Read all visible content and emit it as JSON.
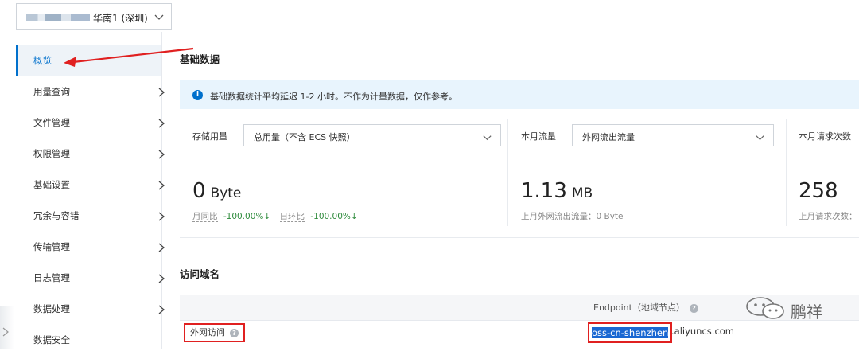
{
  "region": {
    "label": "华南1 (深圳)"
  },
  "sidebar": {
    "items": [
      {
        "label": "概览"
      },
      {
        "label": "用量查询"
      },
      {
        "label": "文件管理"
      },
      {
        "label": "权限管理"
      },
      {
        "label": "基础设置"
      },
      {
        "label": "冗余与容错"
      },
      {
        "label": "传输管理"
      },
      {
        "label": "日志管理"
      },
      {
        "label": "数据处理"
      },
      {
        "label": "数据安全"
      }
    ]
  },
  "basic": {
    "title": "基础数据",
    "info": "基础数据统计平均延迟 1-2 小时。不作为计量数据，仅作参考。",
    "storage": {
      "label": "存储用量",
      "select": "总用量（不含 ECS 快照）",
      "value": "0",
      "unit": "Byte",
      "mom_label": "月同比",
      "mom_value": "-100.00%↓",
      "dod_label": "日环比",
      "dod_value": "-100.00%↓"
    },
    "traffic": {
      "label": "本月流量",
      "select": "外网流出流量",
      "value": "1.13",
      "unit": "MB",
      "sub": "上月外网流出流量：0 Byte"
    },
    "requests": {
      "label": "本月请求次数",
      "value": "258",
      "sub": "上月请求次数："
    }
  },
  "domain": {
    "title": "访问域名",
    "col_endpoint": "Endpoint（地域节点）",
    "row_label": "外网访问",
    "endpoint_highlight": "oss-cn-shenzhen",
    "endpoint_rest": ".aliyuncs.com"
  },
  "watermark": {
    "text": "鹏祥"
  },
  "colors": {
    "accent": "#0070cc",
    "annotation": "#e02020",
    "up_down": "#2e8b3c"
  }
}
